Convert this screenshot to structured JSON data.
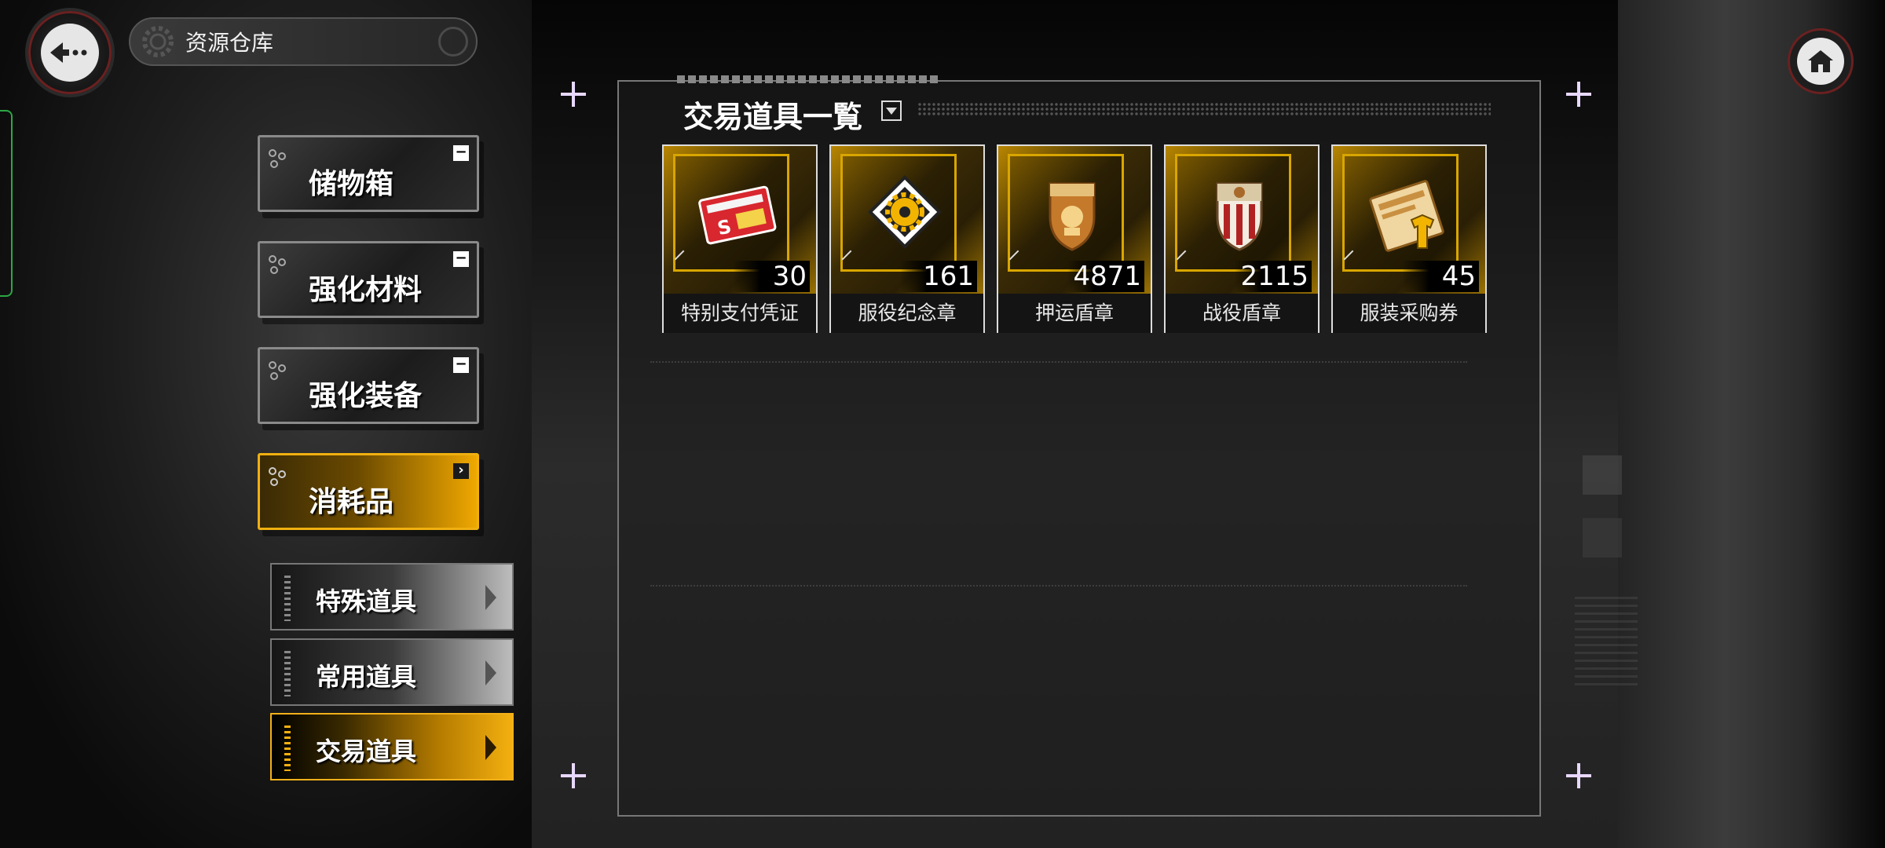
{
  "header": {
    "title": "资源仓库"
  },
  "categories": [
    {
      "label": "储物箱",
      "mini": "−"
    },
    {
      "label": "强化材料",
      "mini": "−"
    },
    {
      "label": "强化装备",
      "mini": "−"
    },
    {
      "label": "消耗品",
      "mini": "›",
      "active": true
    }
  ],
  "subcategories": [
    {
      "label": "特殊道具"
    },
    {
      "label": "常用道具"
    },
    {
      "label": "交易道具",
      "active": true
    }
  ],
  "panel": {
    "title": "交易道具一覧",
    "items": [
      {
        "name": "特别支付凭证",
        "count": "30",
        "icon": "ticket-icon"
      },
      {
        "name": "服役纪念章",
        "count": "161",
        "icon": "gear-medal-icon"
      },
      {
        "name": "押运盾章",
        "count": "4871",
        "icon": "shield-badge-icon"
      },
      {
        "name": "战役盾章",
        "count": "2115",
        "icon": "striped-shield-icon"
      },
      {
        "name": "服装采购券",
        "count": "45",
        "icon": "clothing-coupon-icon"
      }
    ]
  },
  "colors": {
    "accent": "#f0b010",
    "panel_border": "#777777"
  }
}
